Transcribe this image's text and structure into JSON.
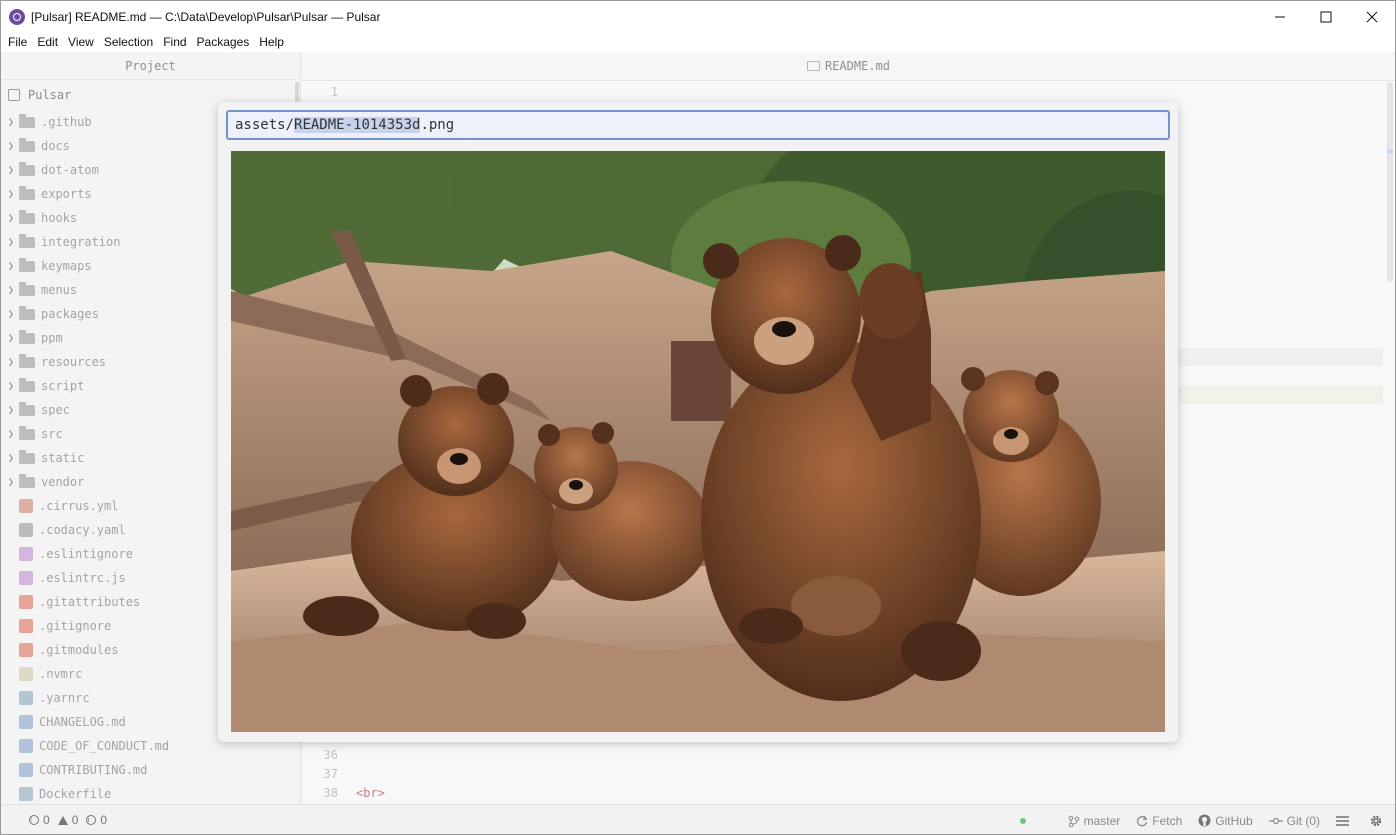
{
  "window": {
    "title": "[Pulsar] README.md — C:\\Data\\Develop\\Pulsar\\Pulsar — Pulsar",
    "controls": [
      "minimize-icon",
      "maximize-icon",
      "close-icon"
    ]
  },
  "menu": [
    "File",
    "Edit",
    "View",
    "Selection",
    "Find",
    "Packages",
    "Help"
  ],
  "tree": {
    "header": "Project",
    "root": "Pulsar",
    "folders": [
      ".github",
      "docs",
      "dot-atom",
      "exports",
      "hooks",
      "integration",
      "keymaps",
      "menus",
      "packages",
      "ppm",
      "resources",
      "script",
      "spec",
      "src",
      "static",
      "vendor"
    ],
    "files": [
      {
        "name": ".cirrus.yml",
        "icon": "yaml-icon",
        "color": "#d79a8a"
      },
      {
        "name": ".codacy.yaml",
        "icon": "codacy-icon",
        "color": "#a9a9a9"
      },
      {
        "name": ".eslintignore",
        "icon": "eslint-icon",
        "color": "#c9a0d6"
      },
      {
        "name": ".eslintrc.js",
        "icon": "eslint-icon",
        "color": "#c9a0d6"
      },
      {
        "name": ".gitattributes",
        "icon": "git-icon",
        "color": "#e08a76"
      },
      {
        "name": ".gitignore",
        "icon": "git-icon",
        "color": "#e08a76"
      },
      {
        "name": ".gitmodules",
        "icon": "git-icon",
        "color": "#e08a76"
      },
      {
        "name": ".nvmrc",
        "icon": "node-icon",
        "color": "#d8d0b4"
      },
      {
        "name": ".yarnrc",
        "icon": "yarn-icon",
        "color": "#9bb7c8"
      },
      {
        "name": "CHANGELOG.md",
        "icon": "markdown-icon",
        "color": "#9ab3d3"
      },
      {
        "name": "CODE_OF_CONDUCT.md",
        "icon": "markdown-icon",
        "color": "#9ab3d3"
      },
      {
        "name": "CONTRIBUTING.md",
        "icon": "markdown-icon",
        "color": "#9ab3d3"
      },
      {
        "name": "Dockerfile",
        "icon": "docker-icon",
        "color": "#9fb6c9"
      }
    ]
  },
  "editor": {
    "tab": "README.md",
    "lines": [
      {
        "num": "1",
        "text": ""
      },
      {
        "num": "36",
        "text": ""
      },
      {
        "num": "37",
        "text": ""
      },
      {
        "num": "38",
        "text": "<br>"
      }
    ]
  },
  "modal": {
    "input_prefix": "assets/",
    "input_selected": "README-1014353d",
    "input_suffix": ".png",
    "preview_alt": "image preview"
  },
  "statusbar": {
    "errors": "0",
    "warnings": "0",
    "infos": "0",
    "branch": "master",
    "fetch": "Fetch",
    "github": "GitHub",
    "git": "Git (0)"
  }
}
